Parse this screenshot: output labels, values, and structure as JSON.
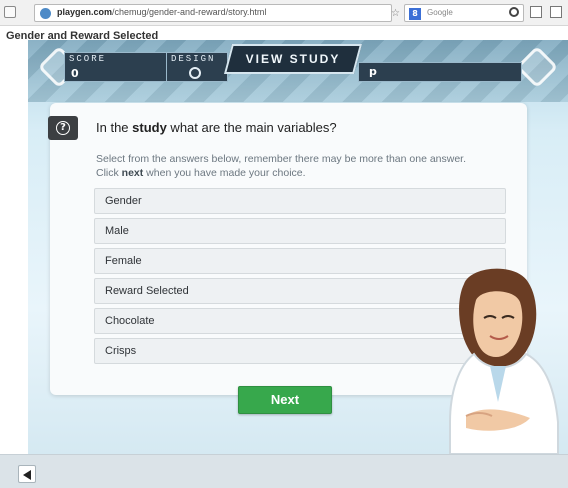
{
  "browser": {
    "url_domain": "playgen.com",
    "url_path": "/chemug/gender-and-reward/story.html",
    "search_engine": "8",
    "search_placeholder": "Google"
  },
  "page": {
    "title": "Gender and Reward Selected"
  },
  "game": {
    "score_label": "SCORE",
    "score_value": "0",
    "design_label": "DESIGN",
    "view_study_label": "VIEW STUDY",
    "p_value": "p",
    "question_prefix": "In the ",
    "question_keyword": "study",
    "question_suffix": " what are the main variables?",
    "instructions_line1": "Select from the answers below, remember there may be more than one answer.",
    "instructions_line2_prefix": "Click ",
    "instructions_line2_keyword": "next",
    "instructions_line2_suffix": " when you have made your choice.",
    "answers": [
      {
        "label": "Gender"
      },
      {
        "label": "Male"
      },
      {
        "label": "Female"
      },
      {
        "label": "Reward Selected"
      },
      {
        "label": "Chocolate"
      },
      {
        "label": "Crisps"
      }
    ],
    "next_label": "Next",
    "help_icon": "?"
  },
  "colors": {
    "next_green": "#37a84c",
    "panel_dark": "#2c3f4f",
    "card_bg": "#f9fbfc",
    "answer_bg": "#eef1f3"
  }
}
